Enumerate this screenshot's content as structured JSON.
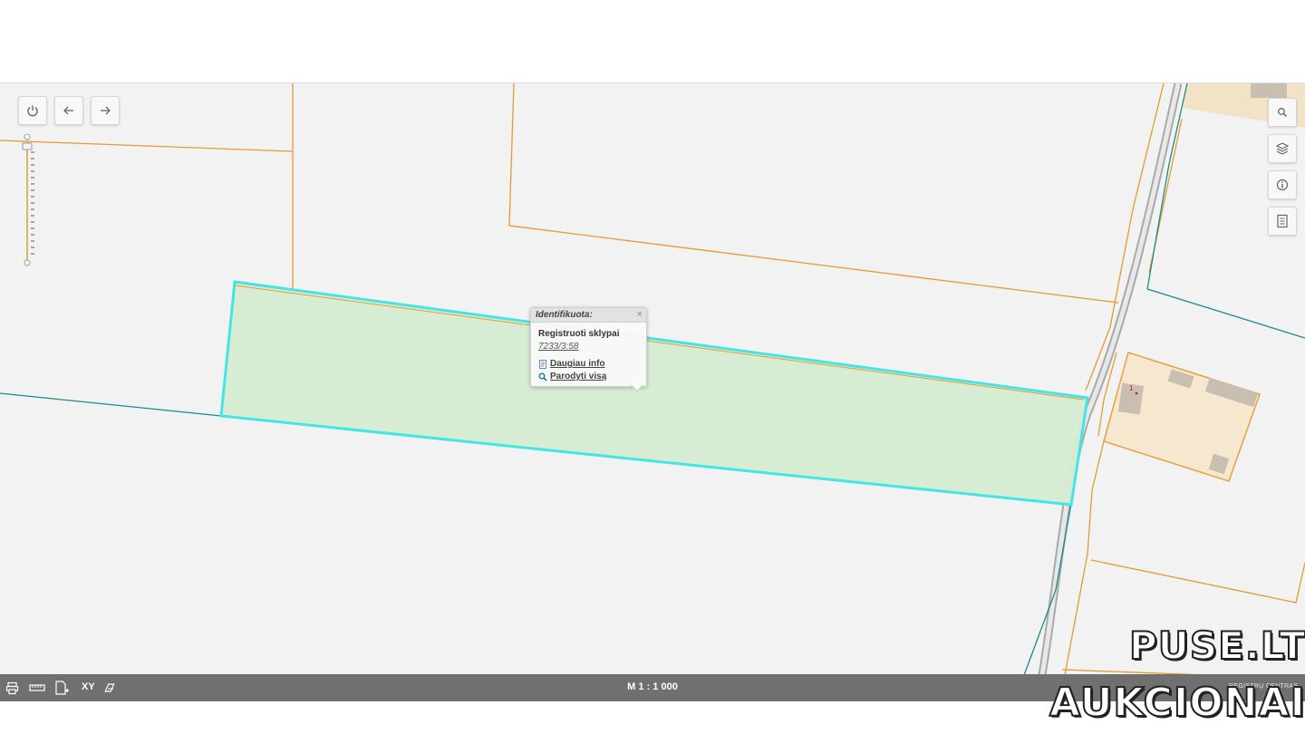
{
  "map": {
    "colors": {
      "background": "#f2f2f2",
      "parcel_border": "#e69a2e",
      "highlight_fill": "#d4ecd1",
      "highlight_border": "#44e5e5",
      "teal_line": "#1d8a8a",
      "building_area": "#f5e8cf",
      "building": "#c8bfb1"
    },
    "controls": {
      "power_icon": "power-icon",
      "back_icon": "arrow-left-icon",
      "forward_icon": "arrow-right-icon"
    },
    "right_toolbar": [
      "search-icon",
      "layers-icon",
      "info-icon",
      "legend-icon"
    ],
    "building_label": "1"
  },
  "popup": {
    "title": "Identifikuota:",
    "close": "×",
    "layer": "Registruoti sklypai",
    "parcel_id": "7233/3:58",
    "more_info": "Daugiau info",
    "show_all": "Parodyti visą"
  },
  "statusbar": {
    "xy_label": "XY",
    "scale": "M 1 : 1 000",
    "credit": "REGISTRŲ CENTRAS"
  },
  "watermark": {
    "line1": "PUSE.LT",
    "line2": "AUKCIONAI"
  }
}
